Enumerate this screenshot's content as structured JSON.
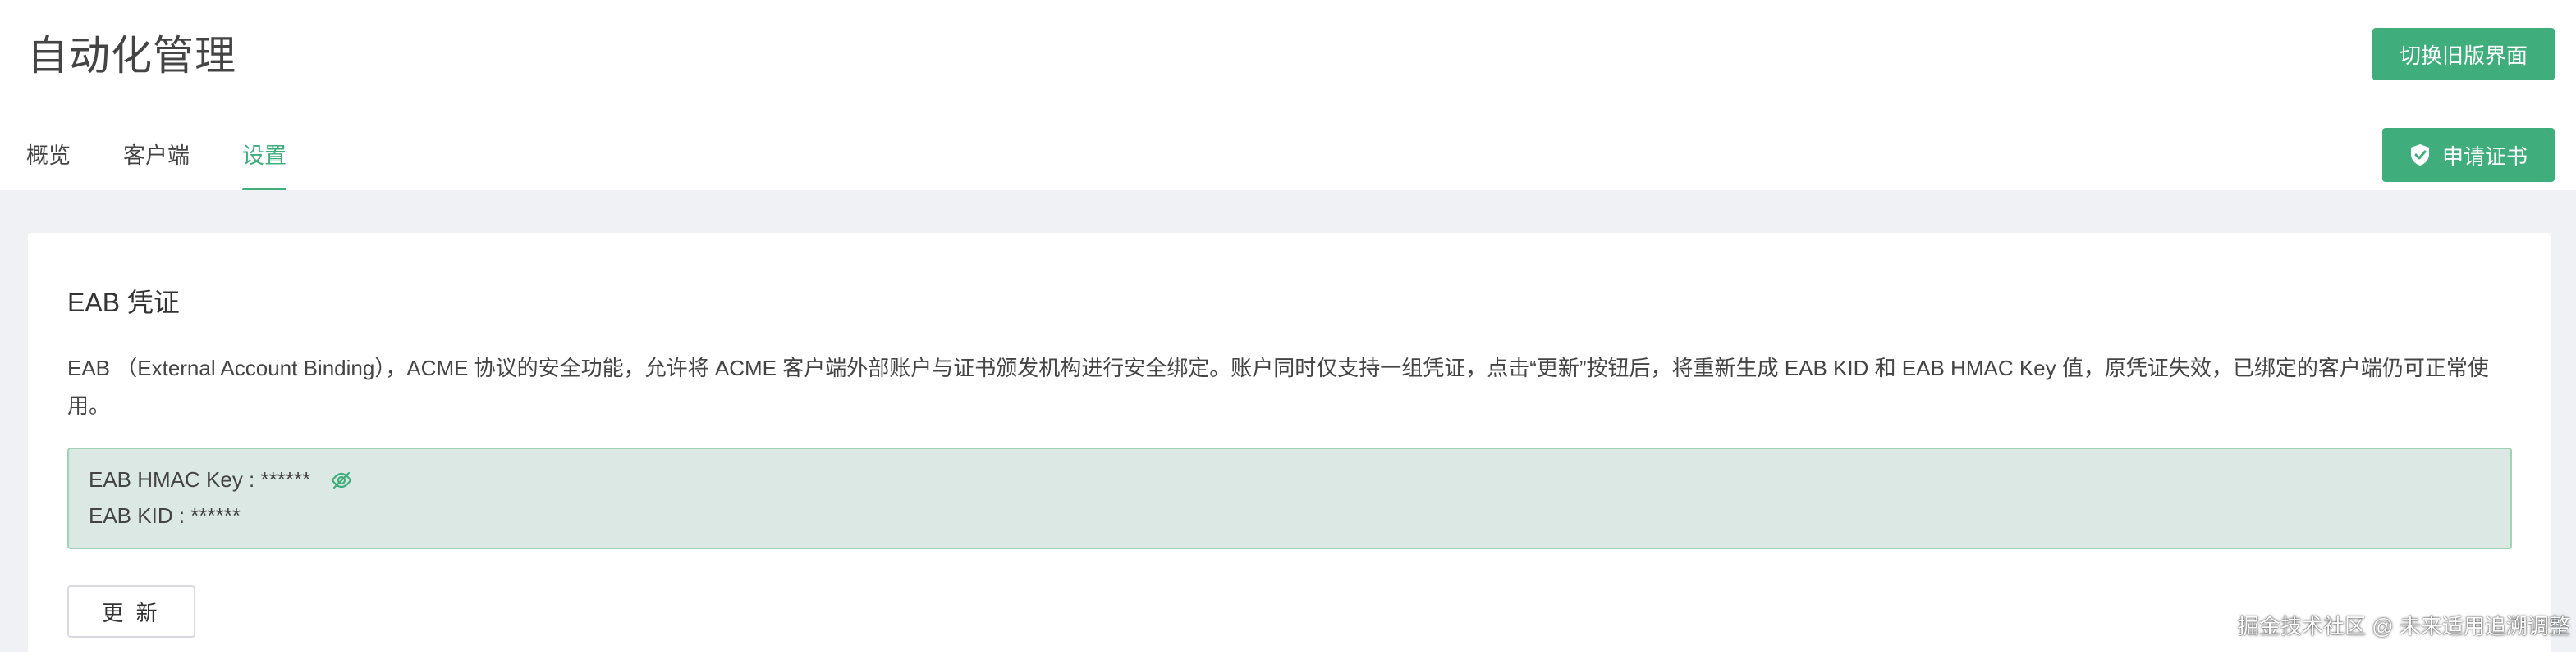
{
  "header": {
    "title": "自动化管理",
    "switch_button": "切换旧版界面",
    "apply_button": "申请证书"
  },
  "tabs": [
    {
      "label": "概览",
      "active": false
    },
    {
      "label": "客户端",
      "active": false
    },
    {
      "label": "设置",
      "active": true
    }
  ],
  "card": {
    "title": "EAB 凭证",
    "description": "EAB （External Account Binding），ACME 协议的安全功能，允许将 ACME 客户端外部账户与证书颁发机构进行安全绑定。账户同时仅支持一组凭证，点击“更新”按钮后，将重新生成 EAB KID 和 EAB HMAC Key 值，原凭证失效，已绑定的客户端仍可正常使用。",
    "hmac_line": "EAB HMAC Key : ******",
    "kid_line": "EAB KID : ******",
    "update_button": "更 新"
  },
  "watermark": "掘金技术社区 @ 未来适用追溯调整",
  "colors": {
    "accent": "#3fae7c",
    "background": "#eff1f4",
    "key_box_bg": "#dce8e4"
  },
  "icons": {
    "apply": "shield-check-icon",
    "toggle_visibility": "eye-off-icon"
  }
}
